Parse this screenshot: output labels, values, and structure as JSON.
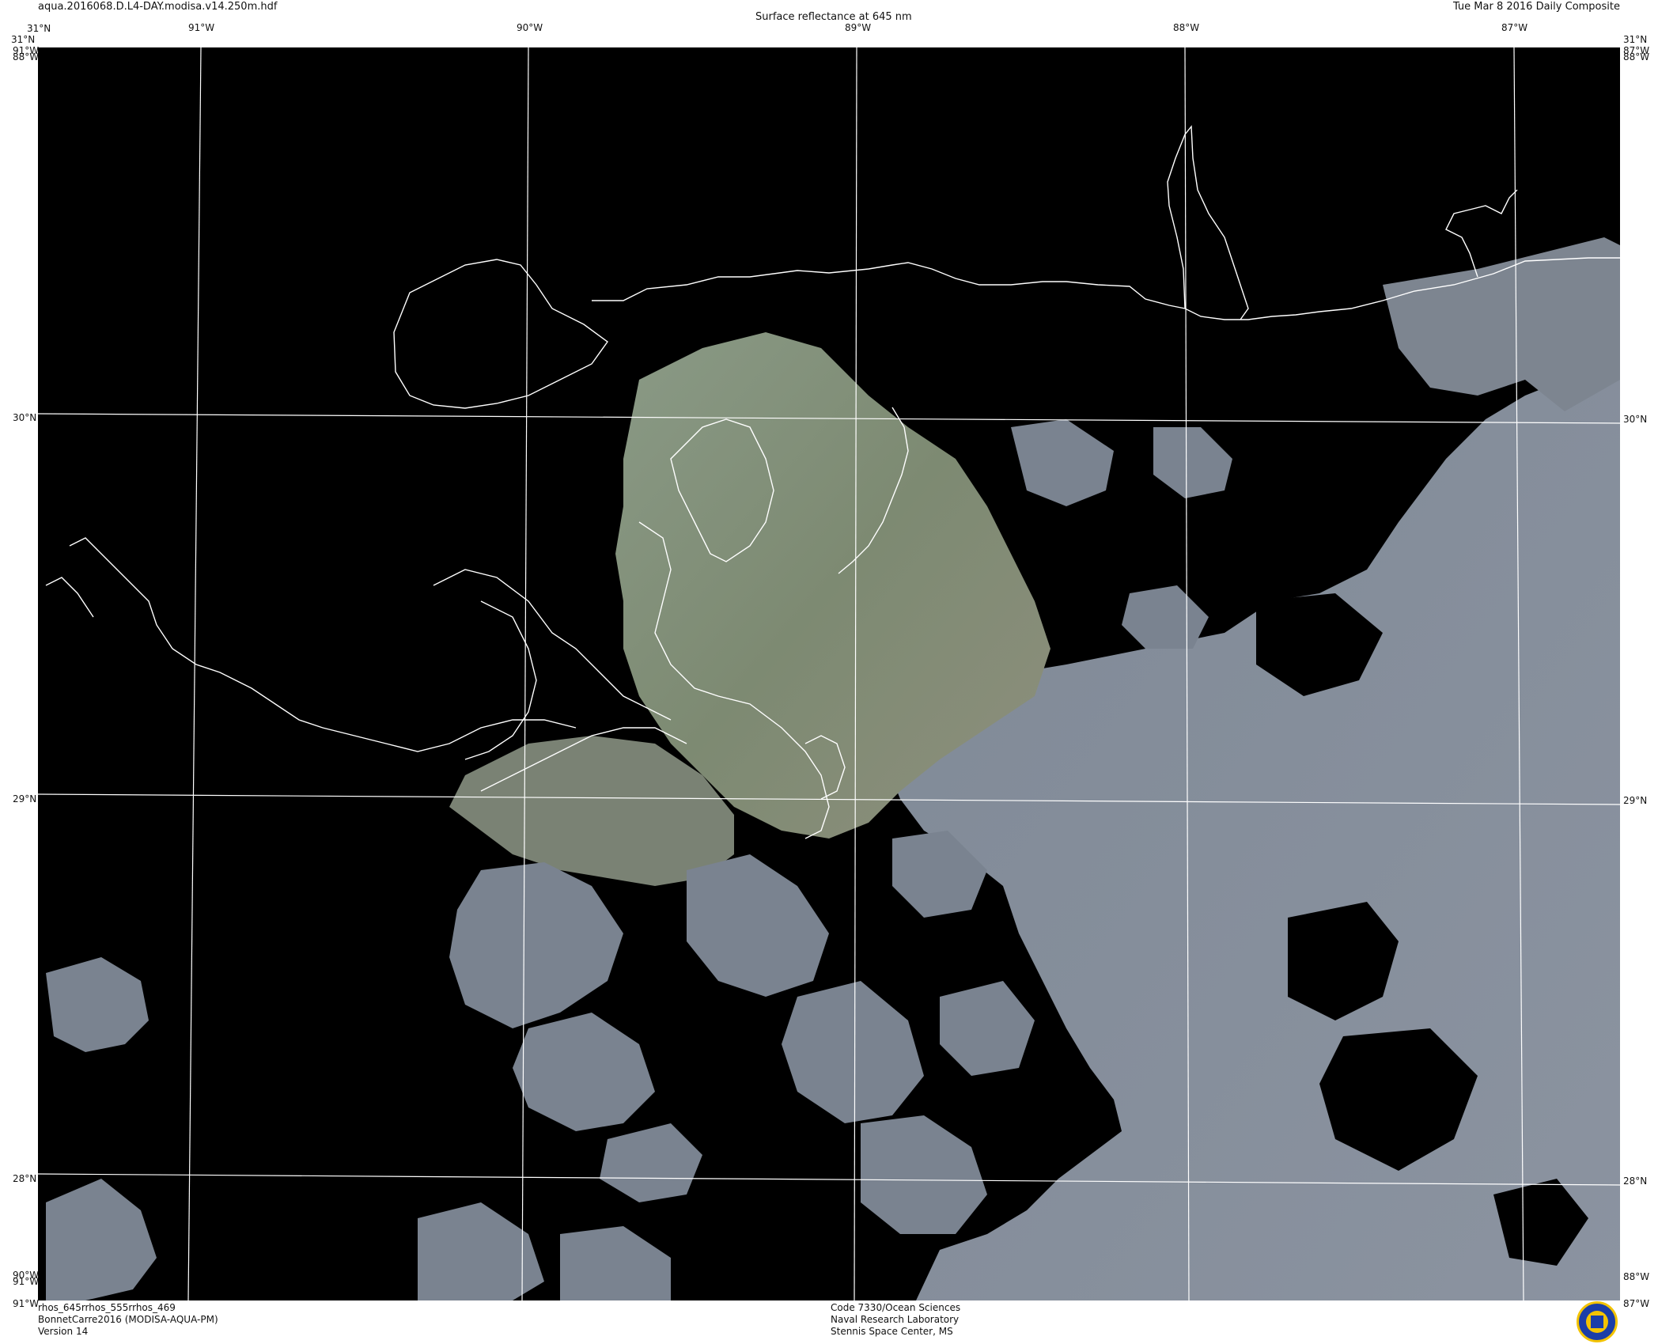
{
  "header": {
    "filename": "aqua.2016068.D.L4-DAY.modisa.v14.250m.hdf",
    "title": "Surface reflectance at 645 nm",
    "date": "Tue Mar  8 2016 Daily Composite"
  },
  "graticule": {
    "top_lon_labels": [
      "91°W",
      "90°W",
      "89°W",
      "88°W",
      "87°W"
    ],
    "bottom_left_lon": "91°W",
    "bottom_left_extra": "90°W",
    "bottom_right_lon": "88°W",
    "bottom_right_lon2": "87°W",
    "left_lat_labels": [
      "31°N",
      "30°N",
      "29°N",
      "28°N"
    ],
    "right_lat_labels": [
      "31°N",
      "30°N",
      "29°N",
      "28°N"
    ],
    "corner_top_left": "31°N",
    "corner_top_left_lon": "91°W",
    "corner_top_left_lon2": "88°W",
    "corner_top_right": "31°N",
    "corner_top_right_lon": "87°W",
    "corner_top_right_lon2": "88°W"
  },
  "footer": {
    "left": [
      "rhos_645rrhos_555rrhos_469",
      "BonnetCarre2016 (MODISA-AQUA-PM)",
      "Version 14"
    ],
    "center": [
      "Code 7330/Ocean Sciences",
      "Naval Research Laboratory",
      "Stennis Space Center, MS"
    ]
  },
  "colors": {
    "background": "#000000",
    "water_gray": "#7e8794",
    "plume_green": "#7c8870",
    "coastline": "#ffffff",
    "grid": "#ffffff"
  },
  "icons": {
    "logo": "nrl-seal-icon"
  }
}
